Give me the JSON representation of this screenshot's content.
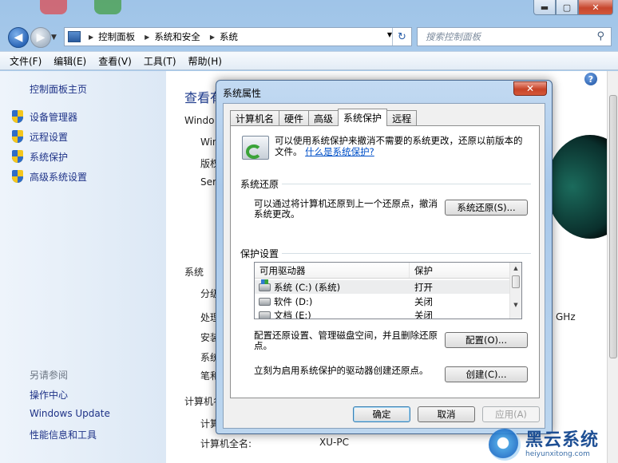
{
  "window": {
    "caption_min": "▬",
    "caption_max": "▢",
    "caption_close": "✕"
  },
  "nav": {
    "back": "◀",
    "forward": "▶",
    "breadcrumb": [
      "控制面板",
      "系统和安全",
      "系统"
    ],
    "search_placeholder": "搜索控制面板"
  },
  "menu": [
    "文件(F)",
    "编辑(E)",
    "查看(V)",
    "工具(T)",
    "帮助(H)"
  ],
  "sidebar": {
    "home": "控制面板主页",
    "tasks": [
      "设备管理器",
      "远程设置",
      "系统保护",
      "高级系统设置"
    ],
    "see_also_title": "另请参阅",
    "see_also": [
      "操作中心",
      "Windows Update",
      "性能信息和工具"
    ]
  },
  "main": {
    "page_title": "查看有",
    "section_windows": "Windo",
    "win_lines": [
      "Win",
      "版权",
      "Ser"
    ],
    "section_system": "系统",
    "sys_lines": [
      "分级",
      "处理",
      "安装",
      "系统",
      "笔和"
    ],
    "ghz": "GHz",
    "section_computer": "计算机名",
    "computer_label_1": "计算",
    "computer_label_2": "计算机全名:",
    "computer_name": "XU-PC"
  },
  "dialog": {
    "title": "系统属性",
    "tabs": [
      "计算机名",
      "硬件",
      "高级",
      "系统保护",
      "远程"
    ],
    "active_tab": "系统保护",
    "info_text": "可以使用系统保护来撤消不需要的系统更改，还原以前版本的文件。",
    "info_link": "什么是系统保护?",
    "restore_group": "系统还原",
    "restore_text": "可以通过将计算机还原到上一个还原点，撤消系统更改。",
    "restore_button": "系统还原(S)...",
    "protect_group": "保护设置",
    "list_headers": [
      "可用驱动器",
      "保护"
    ],
    "drives": [
      {
        "name": "系统 (C:) (系统)",
        "status": "打开"
      },
      {
        "name": "软件 (D:)",
        "status": "关闭"
      },
      {
        "name": "文档 (E:)",
        "status": "关闭"
      }
    ],
    "config_text": "配置还原设置、管理磁盘空间，并且删除还原点。",
    "config_button": "配置(O)...",
    "create_text": "立刻为启用系统保护的驱动器创建还原点。",
    "create_button": "创建(C)...",
    "ok": "确定",
    "cancel": "取消",
    "apply": "应用(A)"
  },
  "watermark": {
    "brand": "黑云系统",
    "url": "heiyunxitong.com"
  }
}
